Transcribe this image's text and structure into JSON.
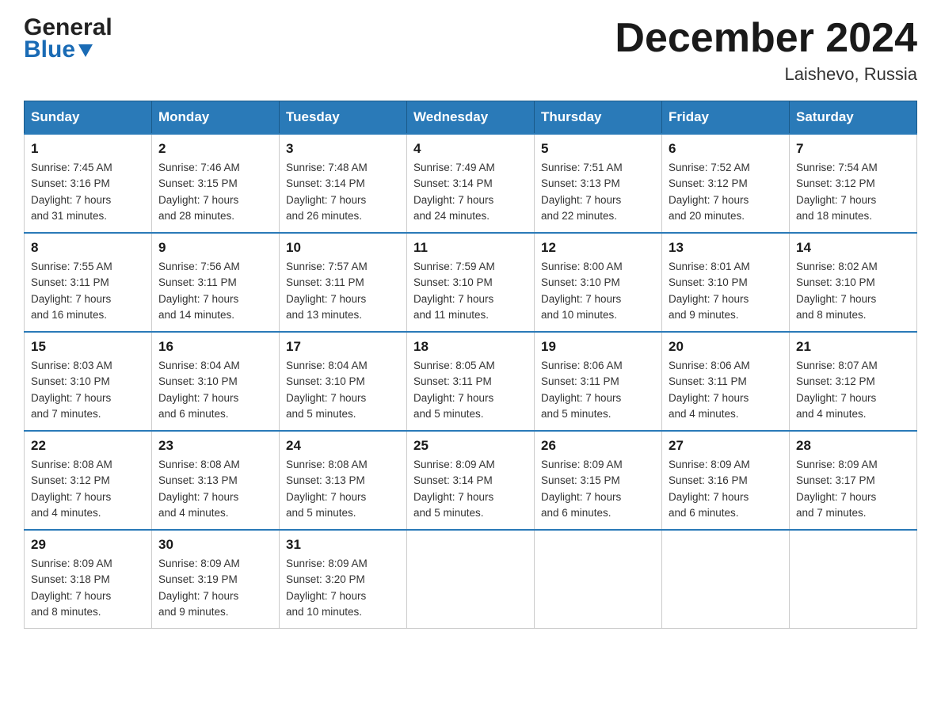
{
  "header": {
    "logo_general": "General",
    "logo_blue": "Blue",
    "month_title": "December 2024",
    "location": "Laishevo, Russia"
  },
  "weekdays": [
    "Sunday",
    "Monday",
    "Tuesday",
    "Wednesday",
    "Thursday",
    "Friday",
    "Saturday"
  ],
  "weeks": [
    [
      {
        "day": "1",
        "sunrise": "7:45 AM",
        "sunset": "3:16 PM",
        "daylight": "7 hours and 31 minutes."
      },
      {
        "day": "2",
        "sunrise": "7:46 AM",
        "sunset": "3:15 PM",
        "daylight": "7 hours and 28 minutes."
      },
      {
        "day": "3",
        "sunrise": "7:48 AM",
        "sunset": "3:14 PM",
        "daylight": "7 hours and 26 minutes."
      },
      {
        "day": "4",
        "sunrise": "7:49 AM",
        "sunset": "3:14 PM",
        "daylight": "7 hours and 24 minutes."
      },
      {
        "day": "5",
        "sunrise": "7:51 AM",
        "sunset": "3:13 PM",
        "daylight": "7 hours and 22 minutes."
      },
      {
        "day": "6",
        "sunrise": "7:52 AM",
        "sunset": "3:12 PM",
        "daylight": "7 hours and 20 minutes."
      },
      {
        "day": "7",
        "sunrise": "7:54 AM",
        "sunset": "3:12 PM",
        "daylight": "7 hours and 18 minutes."
      }
    ],
    [
      {
        "day": "8",
        "sunrise": "7:55 AM",
        "sunset": "3:11 PM",
        "daylight": "7 hours and 16 minutes."
      },
      {
        "day": "9",
        "sunrise": "7:56 AM",
        "sunset": "3:11 PM",
        "daylight": "7 hours and 14 minutes."
      },
      {
        "day": "10",
        "sunrise": "7:57 AM",
        "sunset": "3:11 PM",
        "daylight": "7 hours and 13 minutes."
      },
      {
        "day": "11",
        "sunrise": "7:59 AM",
        "sunset": "3:10 PM",
        "daylight": "7 hours and 11 minutes."
      },
      {
        "day": "12",
        "sunrise": "8:00 AM",
        "sunset": "3:10 PM",
        "daylight": "7 hours and 10 minutes."
      },
      {
        "day": "13",
        "sunrise": "8:01 AM",
        "sunset": "3:10 PM",
        "daylight": "7 hours and 9 minutes."
      },
      {
        "day": "14",
        "sunrise": "8:02 AM",
        "sunset": "3:10 PM",
        "daylight": "7 hours and 8 minutes."
      }
    ],
    [
      {
        "day": "15",
        "sunrise": "8:03 AM",
        "sunset": "3:10 PM",
        "daylight": "7 hours and 7 minutes."
      },
      {
        "day": "16",
        "sunrise": "8:04 AM",
        "sunset": "3:10 PM",
        "daylight": "7 hours and 6 minutes."
      },
      {
        "day": "17",
        "sunrise": "8:04 AM",
        "sunset": "3:10 PM",
        "daylight": "7 hours and 5 minutes."
      },
      {
        "day": "18",
        "sunrise": "8:05 AM",
        "sunset": "3:11 PM",
        "daylight": "7 hours and 5 minutes."
      },
      {
        "day": "19",
        "sunrise": "8:06 AM",
        "sunset": "3:11 PM",
        "daylight": "7 hours and 5 minutes."
      },
      {
        "day": "20",
        "sunrise": "8:06 AM",
        "sunset": "3:11 PM",
        "daylight": "7 hours and 4 minutes."
      },
      {
        "day": "21",
        "sunrise": "8:07 AM",
        "sunset": "3:12 PM",
        "daylight": "7 hours and 4 minutes."
      }
    ],
    [
      {
        "day": "22",
        "sunrise": "8:08 AM",
        "sunset": "3:12 PM",
        "daylight": "7 hours and 4 minutes."
      },
      {
        "day": "23",
        "sunrise": "8:08 AM",
        "sunset": "3:13 PM",
        "daylight": "7 hours and 4 minutes."
      },
      {
        "day": "24",
        "sunrise": "8:08 AM",
        "sunset": "3:13 PM",
        "daylight": "7 hours and 5 minutes."
      },
      {
        "day": "25",
        "sunrise": "8:09 AM",
        "sunset": "3:14 PM",
        "daylight": "7 hours and 5 minutes."
      },
      {
        "day": "26",
        "sunrise": "8:09 AM",
        "sunset": "3:15 PM",
        "daylight": "7 hours and 6 minutes."
      },
      {
        "day": "27",
        "sunrise": "8:09 AM",
        "sunset": "3:16 PM",
        "daylight": "7 hours and 6 minutes."
      },
      {
        "day": "28",
        "sunrise": "8:09 AM",
        "sunset": "3:17 PM",
        "daylight": "7 hours and 7 minutes."
      }
    ],
    [
      {
        "day": "29",
        "sunrise": "8:09 AM",
        "sunset": "3:18 PM",
        "daylight": "7 hours and 8 minutes."
      },
      {
        "day": "30",
        "sunrise": "8:09 AM",
        "sunset": "3:19 PM",
        "daylight": "7 hours and 9 minutes."
      },
      {
        "day": "31",
        "sunrise": "8:09 AM",
        "sunset": "3:20 PM",
        "daylight": "7 hours and 10 minutes."
      },
      null,
      null,
      null,
      null
    ]
  ],
  "labels": {
    "sunrise": "Sunrise:",
    "sunset": "Sunset:",
    "daylight": "Daylight:"
  }
}
